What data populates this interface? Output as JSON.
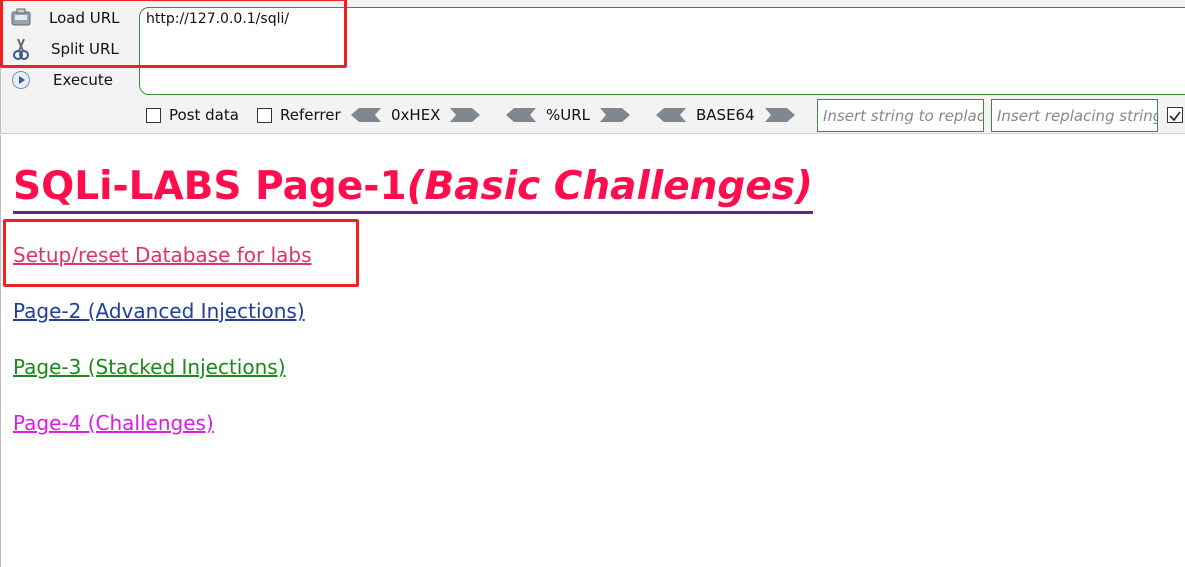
{
  "hackbar": {
    "load_url": "Load URL",
    "split_url": "Split URL",
    "execute": "Execute",
    "url_value": "http://127.0.0.1/sqli/",
    "post_data": "Post data",
    "referrer": "Referrer",
    "hex": "0xHEX",
    "url_enc": "%URL",
    "base64": "BASE64",
    "replace_placeholder": "Insert string to replace",
    "replacing_placeholder": "Insert replacing string"
  },
  "page": {
    "title_main": "SQLi-LABS Page-1",
    "title_sub": "(Basic Challenges)",
    "links": [
      {
        "label": "Setup/reset Database for labs"
      },
      {
        "label": "Page-2 (Advanced Injections)"
      },
      {
        "label": "Page-3 (Stacked Injections)"
      },
      {
        "label": "Page-4 (Challenges)"
      }
    ]
  },
  "colors": {
    "title": "#ff0d4d",
    "link_setup": "#e0326a",
    "link_page2": "#1f3f9a",
    "link_page3": "#1a8a1a",
    "link_page4": "#e01ae8",
    "highlight": "#ee2222"
  }
}
